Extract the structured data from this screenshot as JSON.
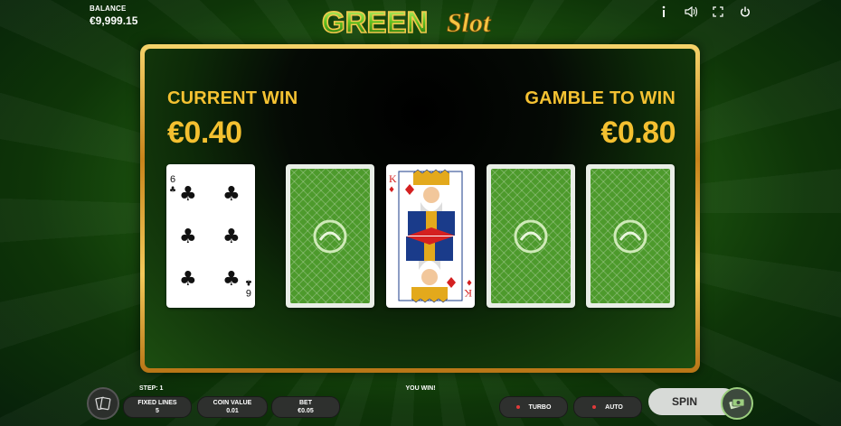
{
  "header": {
    "balance_label": "BALANCE",
    "balance_value": "€9,999.15",
    "logo_text_1": "GREEN",
    "logo_text_2": "Slot",
    "icons": [
      "info-icon",
      "sound-icon",
      "fullscreen-icon",
      "power-icon"
    ]
  },
  "gamble": {
    "current_win_label": "CURRENT WIN",
    "current_win_value": "€0.40",
    "gamble_to_win_label": "GAMBLE TO WIN",
    "gamble_to_win_value": "€0.80",
    "cards": [
      {
        "face": "6 of clubs",
        "rank": "6",
        "suit": "♣"
      },
      {
        "face": "back"
      },
      {
        "face": "K of diamonds",
        "rank": "K",
        "suit": "♦"
      },
      {
        "face": "back"
      },
      {
        "face": "back"
      }
    ]
  },
  "footer": {
    "step": "STEP: 1",
    "message": "YOU WIN!",
    "fixed_lines_label": "FIXED LINES",
    "fixed_lines_value": "5",
    "coin_value_label": "COIN VALUE",
    "coin_value_value": "0.01",
    "bet_label": "BET",
    "bet_value": "€0.05",
    "turbo_label": "TURBO",
    "auto_label": "AUTO",
    "spin_label": "SPIN"
  },
  "colors": {
    "gold": "#f4c030",
    "felt": "#2a6b14",
    "card_back": "#4d9a2c"
  }
}
